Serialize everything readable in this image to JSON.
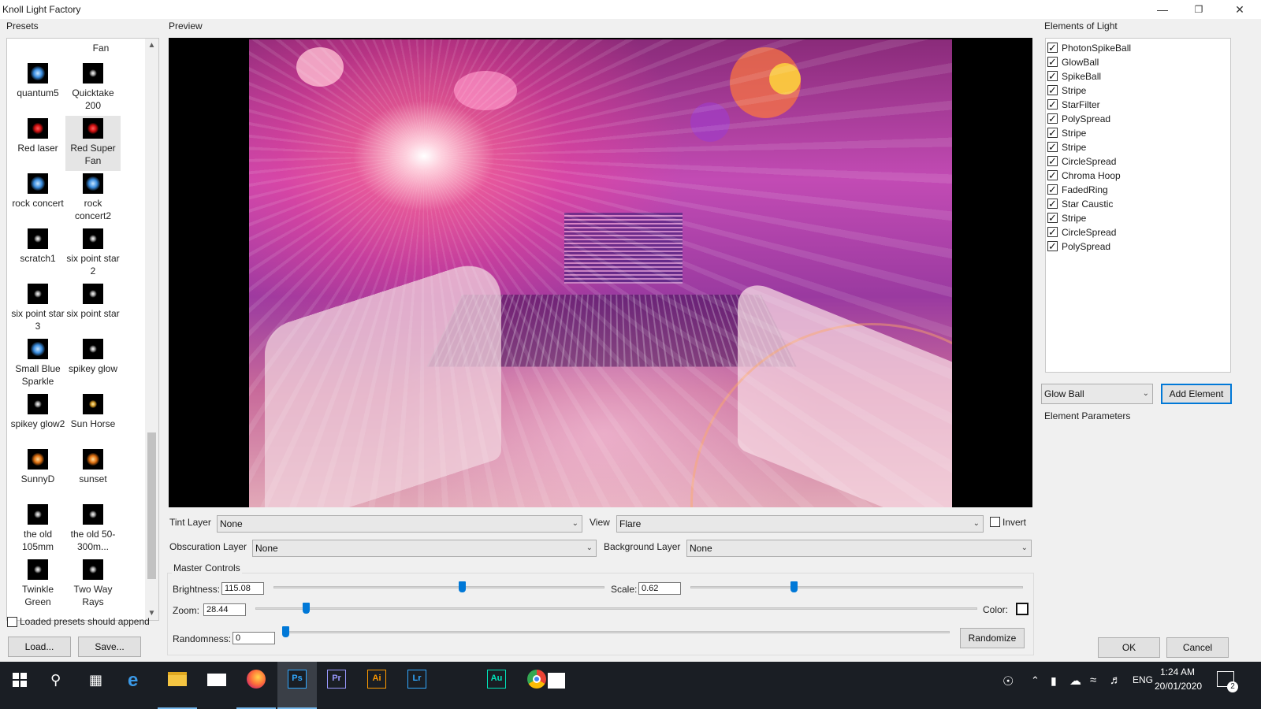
{
  "window": {
    "title": "Knoll Light Factory",
    "minimize": "—",
    "restore": "❐",
    "close": "✕"
  },
  "presets": {
    "label": "Presets",
    "partial_top": [
      "",
      "",
      "Fan"
    ],
    "items": [
      {
        "label": "quantum5",
        "thumb": "blue"
      },
      {
        "label": "Quicktake 200",
        "thumb": "white"
      },
      {
        "label": "Red laser",
        "thumb": "red"
      },
      {
        "label": "Red Super Fan",
        "thumb": "red",
        "selected": true
      },
      {
        "label": "rock concert",
        "thumb": "blue"
      },
      {
        "label": "rock concert2",
        "thumb": "blue"
      },
      {
        "label": "scratch1",
        "thumb": "white"
      },
      {
        "label": "six point star 2",
        "thumb": "white"
      },
      {
        "label": "six point star 3",
        "thumb": "white"
      },
      {
        "label": "six point star",
        "thumb": "white"
      },
      {
        "label": "Small Blue Sparkle",
        "thumb": "blue"
      },
      {
        "label": "spikey glow",
        "thumb": "white"
      },
      {
        "label": "spikey glow2",
        "thumb": "white"
      },
      {
        "label": "Sun Horse",
        "thumb": "gold"
      },
      {
        "label": "SunnyD",
        "thumb": "orange"
      },
      {
        "label": "sunset",
        "thumb": "orange"
      },
      {
        "label": "the old 105mm",
        "thumb": "white"
      },
      {
        "label": "the old 50-300m...",
        "thumb": "white"
      },
      {
        "label": "Twinkle Green",
        "thumb": "white"
      },
      {
        "label": "Two Way Rays",
        "thumb": "white"
      }
    ],
    "append_label": "Loaded presets should append",
    "append_checked": false,
    "load_label": "Load...",
    "save_label": "Save..."
  },
  "preview": {
    "label": "Preview"
  },
  "controls": {
    "tint_layer_label": "Tint Layer",
    "tint_layer_value": "None",
    "view_label": "View",
    "view_value": "Flare",
    "invert_label": "Invert",
    "invert_checked": false,
    "obscuration_label": "Obscuration Layer",
    "obscuration_value": "None",
    "background_label": "Background Layer",
    "background_value": "None"
  },
  "master": {
    "label": "Master Controls",
    "brightness_label": "Brightness:",
    "brightness_value": "115.08",
    "brightness_level": 0.57,
    "scale_label": "Scale:",
    "scale_value": "0.62",
    "scale_level": 0.31,
    "zoom_label": "Zoom:",
    "zoom_value": "28.44",
    "zoom_level": 0.07,
    "color_label": "Color:",
    "randomness_label": "Randomness:",
    "randomness_value": "0",
    "randomness_level": 0.0,
    "randomize_label": "Randomize"
  },
  "elements": {
    "label": "Elements of Light",
    "items": [
      "PhotonSpikeBall",
      "GlowBall",
      "SpikeBall",
      "Stripe",
      "StarFilter",
      "PolySpread",
      "Stripe",
      "Stripe",
      "CircleSpread",
      "Chroma Hoop",
      "FadedRing",
      "Star Caustic",
      "Stripe",
      "CircleSpread",
      "PolySpread"
    ],
    "add_select_value": "Glow Ball",
    "add_label": "Add Element",
    "params_label": "Element Parameters"
  },
  "dialog": {
    "ok_label": "OK",
    "cancel_label": "Cancel"
  },
  "taskbar": {
    "apps": [
      {
        "name": "photoshop",
        "text": "Ps",
        "color": "#31a8ff",
        "active": true
      },
      {
        "name": "premiere",
        "text": "Pr",
        "color": "#9999ff"
      },
      {
        "name": "illustrator",
        "text": "Ai",
        "color": "#ff9a00"
      },
      {
        "name": "lightroom",
        "text": "Lr",
        "color": "#31a8ff"
      },
      {
        "name": "audition",
        "text": "Au",
        "color": "#00e4bb"
      }
    ],
    "language": "ENG",
    "time": "1:24 AM",
    "date": "20/01/2020",
    "notifications": "2"
  }
}
